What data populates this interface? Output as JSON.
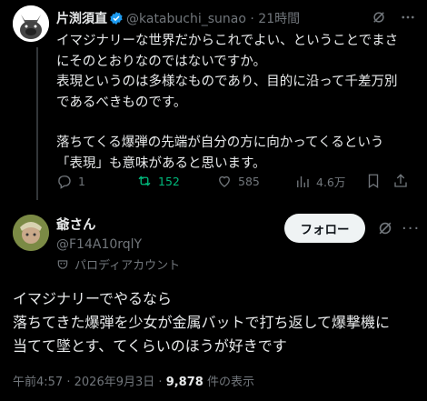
{
  "tweet1": {
    "display_name": "片渕須直",
    "handle": "@katabuchi_sunao",
    "separator": "·",
    "time": "21時間",
    "lines": [
      "イマジナリーな世界だからこれでよい、ということでまさ",
      "にそのとおりなのではないですか。",
      "表現というのは多様なものであり、目的に沿って千差万別",
      "であるべきものです。",
      "",
      "落ちてくる爆弾の先端が自分の方に向かってくるという",
      "「表現」も意味があると思います。"
    ],
    "actions": {
      "replies": "1",
      "retweets": "152",
      "likes": "585",
      "views": "4.6万"
    }
  },
  "tweet2": {
    "display_name": "爺さん",
    "handle": "@F14A10rqlY",
    "follow_label": "フォロー",
    "more_label": "···",
    "parody_label": "パロディアカウント",
    "lines": [
      "イマジナリーでやるなら",
      "落ちてきた爆弾を少女が金属バットで打ち返して爆撃機に",
      "当てて墜とす、てくらいのほうが好きです"
    ],
    "time": "午前4:57",
    "date": "2026年9月3日",
    "views_count": "9,878",
    "views_suffix": "件の表示",
    "separator": "·"
  },
  "colors": {
    "background": "#000000",
    "text": "#e7e9ea",
    "secondary": "#71767b",
    "verified": "#1d9bf0",
    "retweet": "#00ba7c",
    "follow_button": "#eff3f4"
  }
}
